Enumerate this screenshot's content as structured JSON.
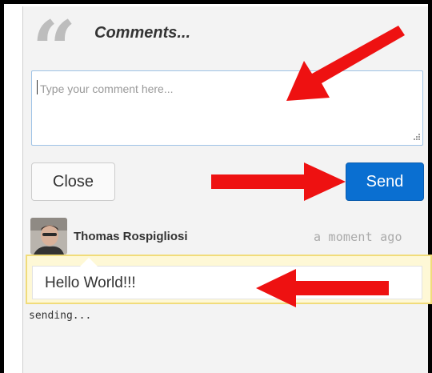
{
  "header": {
    "title": "Comments..."
  },
  "comment_input": {
    "placeholder": "Type your comment here...",
    "value": ""
  },
  "buttons": {
    "close_label": "Close",
    "send_label": "Send"
  },
  "comment": {
    "author": "Thomas Rospigliosi",
    "time": "a moment ago",
    "text": "Hello World!!!",
    "status": "sending..."
  },
  "colors": {
    "send_blue": "#0a6fd1",
    "arrow_red": "#ee1111",
    "bubble_yellow": "#fef8d6",
    "quote_gray": "#bdbdbd"
  },
  "icons": [
    "quote-icon",
    "resize-grip-icon",
    "avatar",
    "annotation-arrow"
  ]
}
